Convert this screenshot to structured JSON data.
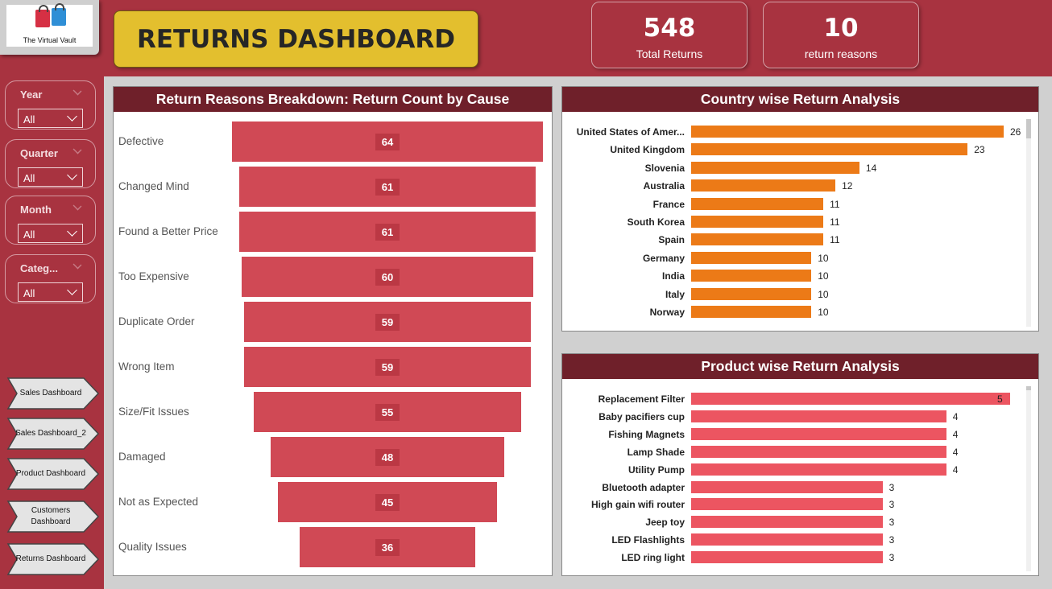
{
  "brand": {
    "logo_text": "The Virtual Vault"
  },
  "header": {
    "title": "RETURNS DASHBOARD"
  },
  "kpis": [
    {
      "value": "548",
      "label": "Total Returns"
    },
    {
      "value": "10",
      "label": "return reasons"
    }
  ],
  "filters": [
    {
      "label": "Year",
      "value": "All"
    },
    {
      "label": "Quarter",
      "value": "All"
    },
    {
      "label": "Month",
      "value": "All"
    },
    {
      "label": "Categ...",
      "value": "All"
    }
  ],
  "nav": [
    {
      "label": "Sales Dashboard"
    },
    {
      "label": "Sales Dashboard_2"
    },
    {
      "label": "Product Dashboard"
    },
    {
      "label": "Customers Dashboard"
    },
    {
      "label": "Returns Dashboard"
    }
  ],
  "colors": {
    "funnel": "#d04955",
    "country": "#ec7a17",
    "product": "#ec5561",
    "header": "#6f202a",
    "accent": "#e3bf2e"
  },
  "chart_data": [
    {
      "type": "funnel",
      "title": "Return Reasons Breakdown: Return Count by Cause",
      "categories": [
        "Defective",
        "Changed Mind",
        "Found a Better Price",
        "Too Expensive",
        "Duplicate Order",
        "Wrong Item",
        "Size/Fit Issues",
        "Damaged",
        "Not as Expected",
        "Quality Issues"
      ],
      "values": [
        64,
        61,
        61,
        60,
        59,
        59,
        55,
        48,
        45,
        36
      ]
    },
    {
      "type": "bar",
      "orientation": "horizontal",
      "title": "Country wise Return Analysis",
      "categories": [
        "United States of Amer...",
        "United Kingdom",
        "Slovenia",
        "Australia",
        "France",
        "South Korea",
        "Spain",
        "Germany",
        "India",
        "Italy",
        "Norway"
      ],
      "values": [
        26,
        23,
        14,
        12,
        11,
        11,
        11,
        10,
        10,
        10,
        10
      ]
    },
    {
      "type": "bar",
      "orientation": "horizontal",
      "title": "Product wise Return Analysis",
      "categories": [
        "Replacement Filter",
        "Baby pacifiers cup",
        "Fishing Magnets",
        "Lamp Shade",
        "Utility Pump",
        "Bluetooth adapter",
        "High gain wifi router",
        "Jeep toy",
        "LED Flashlights",
        "LED ring light"
      ],
      "values": [
        5,
        4,
        4,
        4,
        4,
        3,
        3,
        3,
        3,
        3
      ]
    }
  ]
}
